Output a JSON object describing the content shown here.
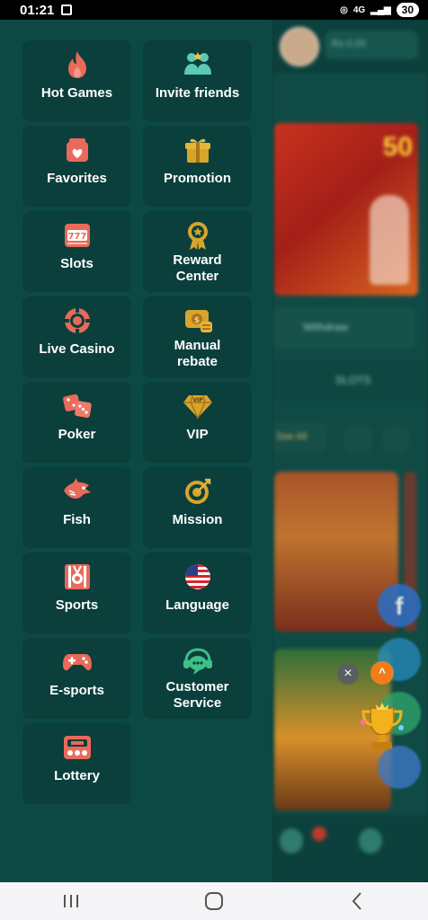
{
  "status_bar": {
    "time": "01:21",
    "network": "4G",
    "battery": "30"
  },
  "menu": [
    {
      "label": "Hot Games",
      "icon": "flame-icon"
    },
    {
      "label": "Invite friends",
      "icon": "invite-friends-icon"
    },
    {
      "label": "Favorites",
      "icon": "favorites-icon"
    },
    {
      "label": "Promotion",
      "icon": "gift-icon"
    },
    {
      "label": "Slots",
      "icon": "slot-machine-icon"
    },
    {
      "label": "Reward\nCenter",
      "icon": "reward-medal-icon"
    },
    {
      "label": "Live Casino",
      "icon": "casino-chip-icon"
    },
    {
      "label": "Manual\nrebate",
      "icon": "rebate-icon"
    },
    {
      "label": "Poker",
      "icon": "dice-icon"
    },
    {
      "label": "VIP",
      "icon": "diamond-icon"
    },
    {
      "label": "Fish",
      "icon": "fish-icon"
    },
    {
      "label": "Mission",
      "icon": "target-icon"
    },
    {
      "label": "Sports",
      "icon": "sports-icon"
    },
    {
      "label": "Language",
      "icon": "us-flag-icon"
    },
    {
      "label": "E-sports",
      "icon": "gamepad-icon"
    },
    {
      "label": "Customer\nService",
      "icon": "customer-service-icon"
    },
    {
      "label": "Lottery",
      "icon": "lottery-icon"
    }
  ],
  "background_page": {
    "balance": "Rs 0.00",
    "banner_text": "50",
    "withdraw_label": "Withdraw",
    "slots_tab": "SLOTS",
    "filter_label": "See All"
  },
  "floating": {
    "close": "×",
    "up": "^"
  },
  "colors": {
    "drawer_bg": "#0d4944",
    "tile_bg": "#0a3f3b",
    "icon_coral": "#e86a5a",
    "icon_gold": "#d8a52c",
    "icon_teal": "#5ccab8"
  }
}
